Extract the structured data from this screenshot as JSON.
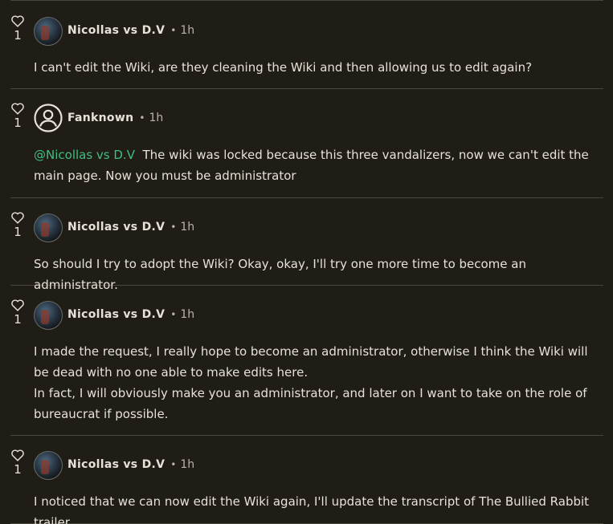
{
  "colors": {
    "background": "#1f1d16",
    "text": "#e6e2d8",
    "muted": "#b8b4aa",
    "mention": "#3fbf7f",
    "divider": "#4a473d"
  },
  "icons": {
    "like": "heart-outline-icon",
    "default_avatar": "user-circle-icon"
  },
  "replies": [
    {
      "likes": "1",
      "author": "Nicollas vs D.V",
      "time": "1h",
      "separator": "•",
      "lines": [
        "I can't edit the Wiki, are they cleaning the Wiki and then allowing us to edit again?"
      ]
    },
    {
      "likes": "1",
      "author": "Fanknown",
      "time": "1h",
      "separator": "•",
      "mention": "@Nicollas vs D.V",
      "lines": [
        "The wiki was locked because this three vandalizers, now we can't edit the main page. Now you must be administrator"
      ]
    },
    {
      "likes": "1",
      "author": "Nicollas vs D.V",
      "time": "1h",
      "separator": "•",
      "lines": [
        "So should I try to adopt the Wiki? Okay, okay, I'll try one more time to become an administrator."
      ]
    },
    {
      "likes": "1",
      "author": "Nicollas vs D.V",
      "time": "1h",
      "separator": "•",
      "lines": [
        "I made the request, I really hope to become an administrator, otherwise I think the Wiki will be dead with no one able to make edits here.",
        "In fact, I will obviously make you an administrator, and later on I want to take on the role of bureaucrat if possible."
      ]
    },
    {
      "likes": "1",
      "author": "Nicollas vs D.V",
      "time": "1h",
      "separator": "•",
      "lines": [
        "I noticed that we can now edit the Wiki again, I'll update the transcript of The Bullied Rabbit trailer."
      ]
    }
  ]
}
